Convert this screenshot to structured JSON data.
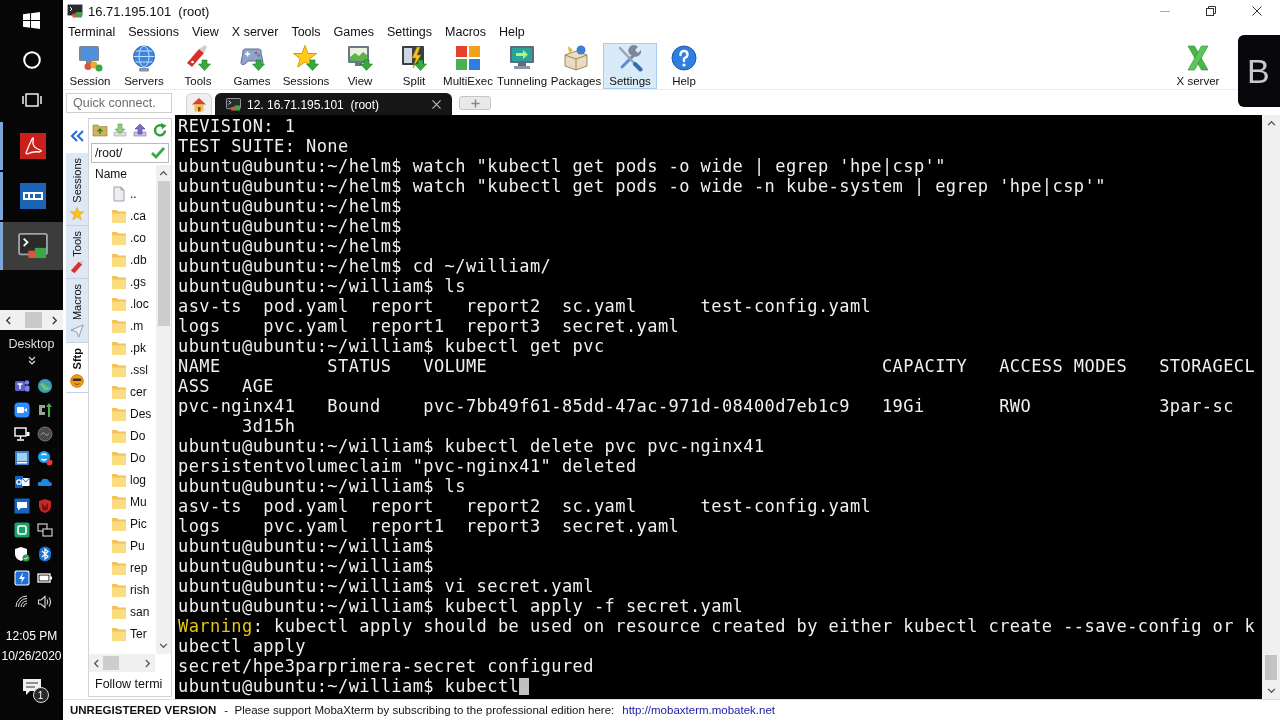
{
  "taskbar": {
    "apps": [
      {
        "kind": "pdf",
        "selected": false
      },
      {
        "kind": "archive",
        "selected": false
      },
      {
        "kind": "terminal",
        "selected": true
      }
    ],
    "desktop_label": "Desktop",
    "time": "12:05 PM",
    "date": "10/26/2020",
    "notification_count": "1"
  },
  "window": {
    "title": "16.71.195.101  (root)"
  },
  "menu": [
    "Terminal",
    "Sessions",
    "View",
    "X server",
    "Tools",
    "Games",
    "Settings",
    "Macros",
    "Help"
  ],
  "toolbar": [
    {
      "kind": "session",
      "label": "Session",
      "hovered": false
    },
    {
      "kind": "servers",
      "label": "Servers",
      "hovered": false
    },
    {
      "kind": "tools",
      "label": "Tools",
      "hovered": false
    },
    {
      "kind": "games",
      "label": "Games",
      "hovered": false
    },
    {
      "kind": "sessions",
      "label": "Sessions",
      "hovered": false
    },
    {
      "kind": "view",
      "label": "View",
      "hovered": false
    },
    {
      "kind": "split",
      "label": "Split",
      "hovered": false
    },
    {
      "kind": "multiexec",
      "label": "MultiExec",
      "hovered": false
    },
    {
      "kind": "tunneling",
      "label": "Tunneling",
      "hovered": false
    },
    {
      "kind": "packages",
      "label": "Packages",
      "hovered": false
    },
    {
      "kind": "settings",
      "label": "Settings",
      "hovered": true
    },
    {
      "kind": "help",
      "label": "Help",
      "hovered": false
    }
  ],
  "toolbar_right": [
    {
      "kind": "xserver",
      "label": "X server",
      "hovered": false
    }
  ],
  "overlay_badge": {
    "text": "B"
  },
  "quick_connect": {
    "placeholder": "Quick connect."
  },
  "session_tabs": [
    {
      "kind": "home",
      "selected": false
    },
    {
      "kind": "session",
      "label": "12. 16.71.195.101  (root)",
      "selected": true
    }
  ],
  "side_tabs": [
    {
      "kind": "sessions",
      "label": "Sessions",
      "selected": false
    },
    {
      "kind": "tools",
      "label": "Tools",
      "selected": false
    },
    {
      "kind": "macros",
      "label": "Macros",
      "selected": false
    },
    {
      "kind": "sftp",
      "label": "Sftp",
      "selected": true
    }
  ],
  "sftp": {
    "path": "/root/",
    "column": "Name",
    "files": [
      {
        "kind": "parent",
        "name": ".."
      },
      {
        "kind": "folder",
        "name": ".ca"
      },
      {
        "kind": "folder",
        "name": ".co"
      },
      {
        "kind": "folder",
        "name": ".db"
      },
      {
        "kind": "folder",
        "name": ".gs"
      },
      {
        "kind": "folder",
        "name": ".loc"
      },
      {
        "kind": "folder",
        "name": ".m"
      },
      {
        "kind": "folder",
        "name": ".pk"
      },
      {
        "kind": "folder",
        "name": ".ssl"
      },
      {
        "kind": "folder",
        "name": "cer"
      },
      {
        "kind": "folder",
        "name": "Des"
      },
      {
        "kind": "folder",
        "name": "Do"
      },
      {
        "kind": "folder",
        "name": "Do"
      },
      {
        "kind": "folder",
        "name": "log"
      },
      {
        "kind": "folder",
        "name": "Mu"
      },
      {
        "kind": "folder",
        "name": "Pic"
      },
      {
        "kind": "folder",
        "name": "Pu"
      },
      {
        "kind": "folder",
        "name": "rep"
      },
      {
        "kind": "folder",
        "name": "rish"
      },
      {
        "kind": "folder",
        "name": "san"
      },
      {
        "kind": "folder",
        "name": "Ter"
      }
    ],
    "follow_terminal": "Follow termi"
  },
  "terminal": {
    "cursor_visible": true,
    "lines": [
      {
        "kind": "plain",
        "text": "REVISION: 1"
      },
      {
        "kind": "plain",
        "text": "TEST SUITE: None"
      },
      {
        "kind": "plain",
        "text": "ubuntu@ubuntu:~/helm$ watch \"kubectl get pods -o wide | egrep 'hpe|csp'\""
      },
      {
        "kind": "plain",
        "text": "ubuntu@ubuntu:~/helm$ watch \"kubectl get pods -o wide -n kube-system | egrep 'hpe|csp'\""
      },
      {
        "kind": "plain",
        "text": "ubuntu@ubuntu:~/helm$"
      },
      {
        "kind": "plain",
        "text": "ubuntu@ubuntu:~/helm$"
      },
      {
        "kind": "plain",
        "text": "ubuntu@ubuntu:~/helm$"
      },
      {
        "kind": "plain",
        "text": "ubuntu@ubuntu:~/helm$ cd ~/william/"
      },
      {
        "kind": "plain",
        "text": "ubuntu@ubuntu:~/william$ ls"
      },
      {
        "kind": "plain",
        "text": "asv-ts  pod.yaml  report   report2  sc.yaml      test-config.yaml"
      },
      {
        "kind": "plain",
        "text": "logs    pvc.yaml  report1  report3  secret.yaml"
      },
      {
        "kind": "plain",
        "text": "ubuntu@ubuntu:~/william$ kubectl get pvc"
      },
      {
        "kind": "plain",
        "text": "NAME          STATUS   VOLUME                                     CAPACITY   ACCESS MODES   STORAGECL"
      },
      {
        "kind": "plain",
        "text": "ASS   AGE"
      },
      {
        "kind": "plain",
        "text": "pvc-nginx41   Bound    pvc-7bb49f61-85dd-47ac-971d-08400d7eb1c9   19Gi       RWO            3par-sc"
      },
      {
        "kind": "plain",
        "text": "      3d15h"
      },
      {
        "kind": "plain",
        "text": "ubuntu@ubuntu:~/william$ kubectl delete pvc pvc-nginx41"
      },
      {
        "kind": "plain",
        "text": "persistentvolumeclaim \"pvc-nginx41\" deleted"
      },
      {
        "kind": "plain",
        "text": "ubuntu@ubuntu:~/william$ ls"
      },
      {
        "kind": "plain",
        "text": "asv-ts  pod.yaml  report   report2  sc.yaml      test-config.yaml"
      },
      {
        "kind": "plain",
        "text": "logs    pvc.yaml  report1  report3  secret.yaml"
      },
      {
        "kind": "plain",
        "text": "ubuntu@ubuntu:~/william$"
      },
      {
        "kind": "plain",
        "text": "ubuntu@ubuntu:~/william$"
      },
      {
        "kind": "plain",
        "text": "ubuntu@ubuntu:~/william$ vi secret.yaml"
      },
      {
        "kind": "plain",
        "text": "ubuntu@ubuntu:~/william$ kubectl apply -f secret.yaml"
      },
      {
        "kind": "warning",
        "label": "Warning",
        "text": ": kubectl apply should be used on resource created by either kubectl create --save-config or k"
      },
      {
        "kind": "plain",
        "text": "ubectl apply"
      },
      {
        "kind": "plain",
        "text": "secret/hpe3parprimera-secret configured"
      },
      {
        "kind": "plain",
        "text": "ubuntu@ubuntu:~/william$ kubectl"
      }
    ]
  },
  "status_bar": {
    "notice": "UNREGISTERED VERSION",
    "message": "-  Please support MobaXterm by subscribing to the professional edition here:",
    "link": "http://mobaxterm.mobatek.net"
  }
}
